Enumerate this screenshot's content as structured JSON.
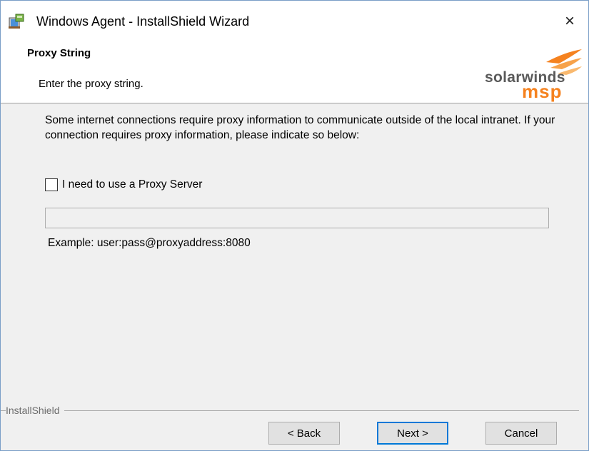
{
  "window": {
    "title": "Windows Agent - InstallShield Wizard",
    "close_glyph": "×"
  },
  "header": {
    "title": "Proxy String",
    "subtitle": "Enter the proxy string.",
    "logo": {
      "word": "solarwinds",
      "suffix": "msp",
      "colors": {
        "orange": "#f5821f",
        "gray": "#5a5a5a"
      }
    }
  },
  "body": {
    "description": "Some internet connections require proxy information to communicate outside of the local intranet.  If your connection requires proxy information, please indicate so below:",
    "proxy_checkbox": {
      "label": "I need to use a Proxy Server",
      "checked": false
    },
    "proxy_input": {
      "value": "",
      "placeholder": ""
    },
    "example": "Example: user:pass@proxyaddress:8080"
  },
  "footer": {
    "brand": "InstallShield",
    "buttons": {
      "back": "< Back",
      "next": "Next >",
      "cancel": "Cancel"
    }
  },
  "icons": {
    "app": "installer-package-icon",
    "close": "close-icon",
    "checkbox": "checkbox-unchecked-icon"
  },
  "colors": {
    "accent": "#0078d7",
    "background": "#f0f0f0"
  }
}
